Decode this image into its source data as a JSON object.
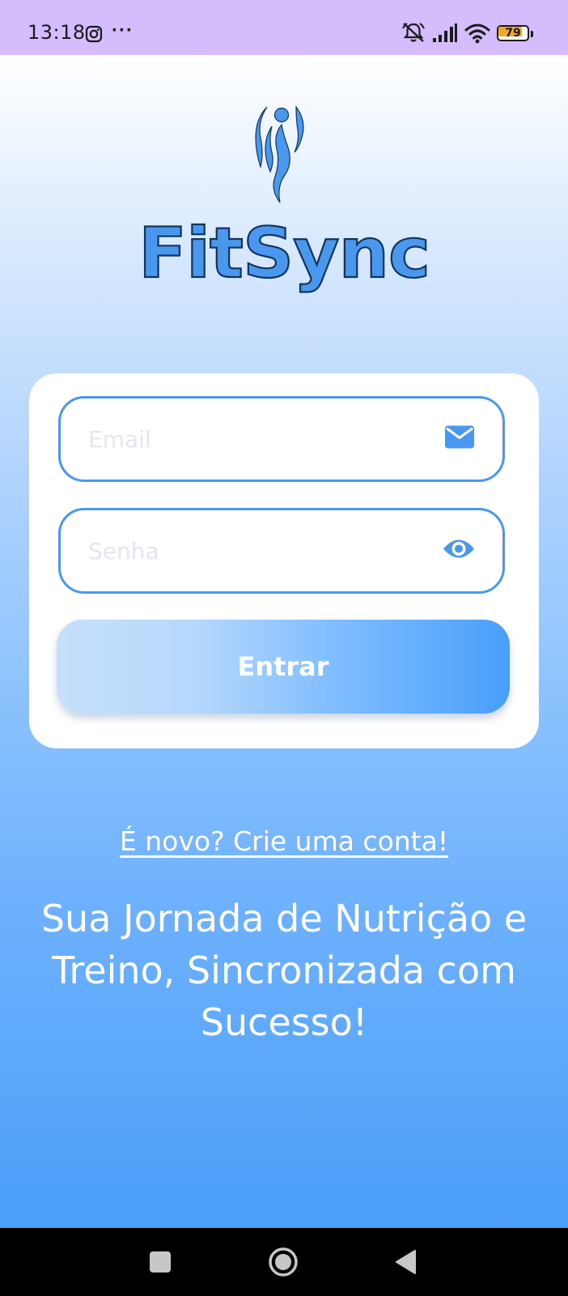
{
  "status_bar": {
    "time": "13:18",
    "more_indicator": "···",
    "battery_level": "79",
    "icons": [
      "instagram-icon",
      "silent-mode-icon",
      "signal-icon",
      "wifi-icon",
      "battery-icon"
    ]
  },
  "brand": {
    "name": "FitSync",
    "color": "#4a97ee"
  },
  "login_form": {
    "email_placeholder": "Email",
    "email_icon": "envelope-icon",
    "password_placeholder": "Senha",
    "password_icon": "eye-icon",
    "submit_label": "Entrar"
  },
  "signup_link": "É novo? Crie uma conta!",
  "tagline": "Sua Jornada de Nutrição e Treino, Sincronizada com Sucesso!",
  "nav_bar": {
    "buttons": [
      "recents-button",
      "home-button",
      "back-button"
    ]
  }
}
